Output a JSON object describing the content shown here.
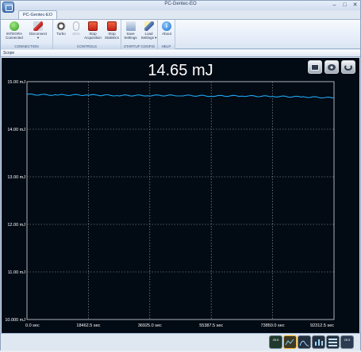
{
  "window": {
    "title": "PC-Gentec-EO",
    "controls": {
      "minimize": "–",
      "maximize": "□",
      "close": "✕"
    }
  },
  "ribbon": {
    "tab_label": "PC-Gentec-EO",
    "groups": [
      {
        "label": "CONNECTION",
        "buttons": [
          {
            "label_line1": "INTEGRA",
            "label_line2": "Connected",
            "icon": "connected-icon"
          },
          {
            "label_line1": "Disconnect",
            "label_line2": "▾",
            "icon": "disconnect-plug-icon"
          }
        ]
      },
      {
        "label": "CONTROLS",
        "buttons": [
          {
            "label_line1": "Turbo",
            "label_line2": "",
            "icon": "turbo-icon"
          },
          {
            "label_line1": "Zero",
            "label_line2": "",
            "icon": "zero-icon"
          },
          {
            "label_line1": "Stop",
            "label_line2": "Acquisition",
            "icon": "stop-icon"
          },
          {
            "label_line1": "Stop",
            "label_line2": "Statistics",
            "icon": "stop-icon"
          }
        ]
      },
      {
        "label": "STARTUP CONFIG",
        "buttons": [
          {
            "label_line1": "Save",
            "label_line2": "Settings",
            "icon": "save-settings-icon"
          },
          {
            "label_line1": "Load",
            "label_line2": "Settings ▾",
            "icon": "load-settings-icon"
          }
        ]
      },
      {
        "label": "HELP",
        "buttons": [
          {
            "label_line1": "About",
            "label_line2": "",
            "icon": "info-icon"
          }
        ]
      }
    ]
  },
  "scope": {
    "panel_title": "Scope",
    "reading": "14.65 mJ",
    "toolbar_icons": [
      "display-icon",
      "settings-gears-icon",
      "refresh-icon"
    ]
  },
  "chart_data": {
    "type": "line",
    "y_tick_labels": [
      "15.00 mJ",
      "14.00 mJ",
      "13.00 mJ",
      "12.00 mJ",
      "11.00 mJ",
      "10.000 mJ"
    ],
    "x_tick_labels": [
      "0.0 sec",
      "18462.5 sec",
      "36925.0 sec",
      "55387.5 sec",
      "73850.0 sec",
      "92312.5 sec"
    ],
    "xlim": [
      0,
      92312.5
    ],
    "ylim": [
      10,
      15
    ],
    "grid": true,
    "series": [
      {
        "color": "#1ea7f2",
        "x": [
          0,
          9231.25,
          18462.5,
          27693.75,
          36925,
          46156.25,
          55387.5,
          64618.75,
          73850,
          83081.25,
          92312.5
        ],
        "y": [
          14.73,
          14.72,
          14.72,
          14.71,
          14.71,
          14.71,
          14.7,
          14.7,
          14.69,
          14.68,
          14.66
        ]
      }
    ],
    "colors": {
      "background": "#020a13",
      "grid": "#9ea6b0",
      "axis": "#d7dde4",
      "text": "#ffffff"
    }
  },
  "status_bar": {
    "chips": [
      {
        "text": "25.5",
        "icon": "ok-display-icon"
      },
      {
        "text": "",
        "icon": "trend-chart-icon"
      },
      {
        "text": "",
        "icon": "histogram-icon"
      },
      {
        "text": "",
        "icon": "bar-chart-icon"
      },
      {
        "text": "",
        "icon": "statistics-bars-icon"
      },
      {
        "text": "25.5",
        "icon": "numeric-display-icon"
      }
    ]
  }
}
